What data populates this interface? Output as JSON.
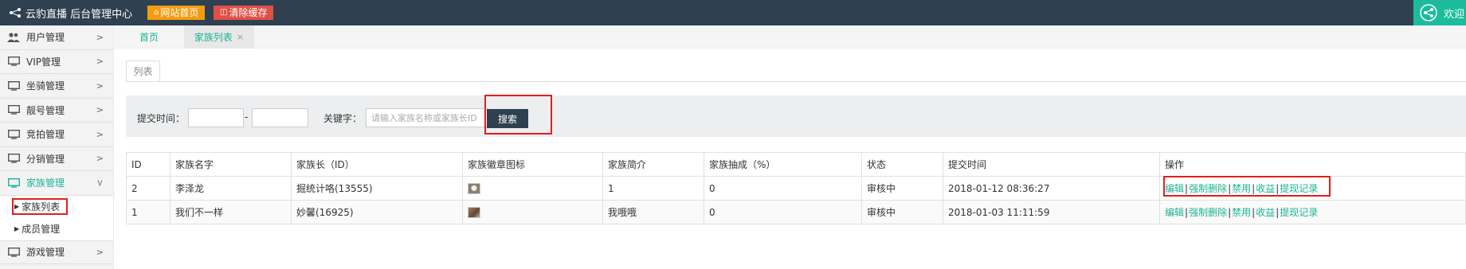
{
  "topbar": {
    "brand": "云豹直播 后台管理中心",
    "home_button": "网站首页",
    "clear_cache_button": "清除缓存",
    "welcome": "欢迎"
  },
  "sidebar": {
    "items": [
      {
        "label": "用户管理",
        "icon": "users-icon"
      },
      {
        "label": "VIP管理",
        "icon": "monitor-icon"
      },
      {
        "label": "坐骑管理",
        "icon": "monitor-icon"
      },
      {
        "label": "靓号管理",
        "icon": "monitor-icon"
      },
      {
        "label": "竞拍管理",
        "icon": "monitor-icon"
      },
      {
        "label": "分销管理",
        "icon": "monitor-icon"
      },
      {
        "label": "家族管理",
        "icon": "monitor-icon"
      }
    ],
    "sub_items": [
      {
        "label": "家族列表"
      },
      {
        "label": "成员管理"
      }
    ],
    "last_item": {
      "label": "游戏管理",
      "icon": "monitor-icon"
    }
  },
  "tabs": {
    "home": "首页",
    "active": "家族列表"
  },
  "content": {
    "subtab": "列表",
    "search": {
      "time_label": "提交时间：",
      "dash": "-",
      "keyword_label": "关键字：",
      "keyword_placeholder": "请输入家族名称或家族长ID",
      "button": "搜索"
    },
    "table": {
      "headers": [
        "ID",
        "家族名字",
        "家族长（ID）",
        "家族徽章图标",
        "家族简介",
        "家族抽成（%）",
        "状态",
        "提交时间",
        "操作"
      ],
      "rows": [
        {
          "id": "2",
          "name": "李泽龙",
          "leader": "掘统计咯(13555)",
          "intro": "1",
          "rate": "0",
          "status": "审核中",
          "time": "2018-01-12 08:36:27"
        },
        {
          "id": "1",
          "name": "我们不一样",
          "leader": "妙馨(16925)",
          "intro": "我哦哦",
          "rate": "0",
          "status": "审核中",
          "time": "2018-01-03 11:11:59"
        }
      ],
      "ops": {
        "edit": "编辑",
        "force_delete": "强制删除",
        "ban": "禁用",
        "income": "收益",
        "withdraw": "提现记录",
        "sep": "|"
      }
    }
  },
  "colors": {
    "topbar": "#2f4050",
    "accent": "#1ab394",
    "highlight": "#e21e1e",
    "home_btn": "#f39c12",
    "cache_btn": "#e05046"
  }
}
